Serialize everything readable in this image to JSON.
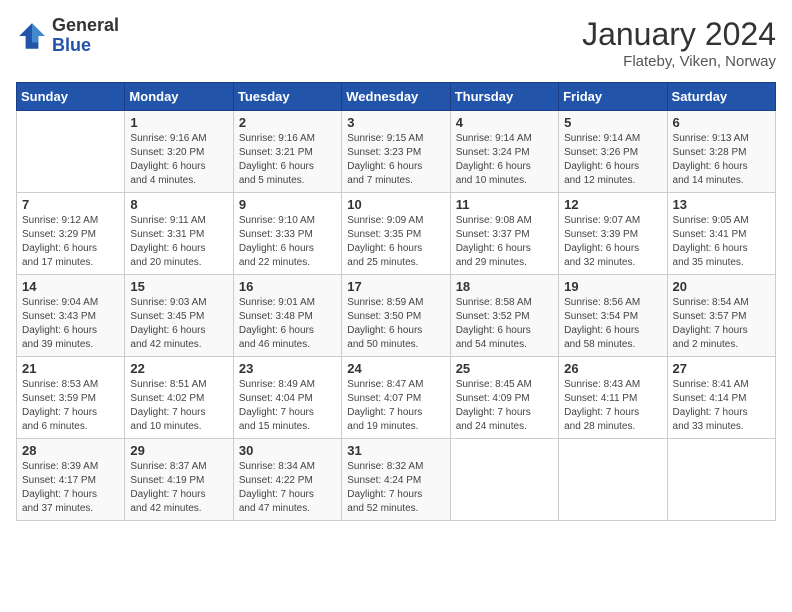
{
  "logo": {
    "general": "General",
    "blue": "Blue"
  },
  "title": "January 2024",
  "location": "Flateby, Viken, Norway",
  "days_of_week": [
    "Sunday",
    "Monday",
    "Tuesday",
    "Wednesday",
    "Thursday",
    "Friday",
    "Saturday"
  ],
  "weeks": [
    [
      {
        "day": "",
        "detail": ""
      },
      {
        "day": "1",
        "detail": "Sunrise: 9:16 AM\nSunset: 3:20 PM\nDaylight: 6 hours\nand 4 minutes."
      },
      {
        "day": "2",
        "detail": "Sunrise: 9:16 AM\nSunset: 3:21 PM\nDaylight: 6 hours\nand 5 minutes."
      },
      {
        "day": "3",
        "detail": "Sunrise: 9:15 AM\nSunset: 3:23 PM\nDaylight: 6 hours\nand 7 minutes."
      },
      {
        "day": "4",
        "detail": "Sunrise: 9:14 AM\nSunset: 3:24 PM\nDaylight: 6 hours\nand 10 minutes."
      },
      {
        "day": "5",
        "detail": "Sunrise: 9:14 AM\nSunset: 3:26 PM\nDaylight: 6 hours\nand 12 minutes."
      },
      {
        "day": "6",
        "detail": "Sunrise: 9:13 AM\nSunset: 3:28 PM\nDaylight: 6 hours\nand 14 minutes."
      }
    ],
    [
      {
        "day": "7",
        "detail": "Sunrise: 9:12 AM\nSunset: 3:29 PM\nDaylight: 6 hours\nand 17 minutes."
      },
      {
        "day": "8",
        "detail": "Sunrise: 9:11 AM\nSunset: 3:31 PM\nDaylight: 6 hours\nand 20 minutes."
      },
      {
        "day": "9",
        "detail": "Sunrise: 9:10 AM\nSunset: 3:33 PM\nDaylight: 6 hours\nand 22 minutes."
      },
      {
        "day": "10",
        "detail": "Sunrise: 9:09 AM\nSunset: 3:35 PM\nDaylight: 6 hours\nand 25 minutes."
      },
      {
        "day": "11",
        "detail": "Sunrise: 9:08 AM\nSunset: 3:37 PM\nDaylight: 6 hours\nand 29 minutes."
      },
      {
        "day": "12",
        "detail": "Sunrise: 9:07 AM\nSunset: 3:39 PM\nDaylight: 6 hours\nand 32 minutes."
      },
      {
        "day": "13",
        "detail": "Sunrise: 9:05 AM\nSunset: 3:41 PM\nDaylight: 6 hours\nand 35 minutes."
      }
    ],
    [
      {
        "day": "14",
        "detail": "Sunrise: 9:04 AM\nSunset: 3:43 PM\nDaylight: 6 hours\nand 39 minutes."
      },
      {
        "day": "15",
        "detail": "Sunrise: 9:03 AM\nSunset: 3:45 PM\nDaylight: 6 hours\nand 42 minutes."
      },
      {
        "day": "16",
        "detail": "Sunrise: 9:01 AM\nSunset: 3:48 PM\nDaylight: 6 hours\nand 46 minutes."
      },
      {
        "day": "17",
        "detail": "Sunrise: 8:59 AM\nSunset: 3:50 PM\nDaylight: 6 hours\nand 50 minutes."
      },
      {
        "day": "18",
        "detail": "Sunrise: 8:58 AM\nSunset: 3:52 PM\nDaylight: 6 hours\nand 54 minutes."
      },
      {
        "day": "19",
        "detail": "Sunrise: 8:56 AM\nSunset: 3:54 PM\nDaylight: 6 hours\nand 58 minutes."
      },
      {
        "day": "20",
        "detail": "Sunrise: 8:54 AM\nSunset: 3:57 PM\nDaylight: 7 hours\nand 2 minutes."
      }
    ],
    [
      {
        "day": "21",
        "detail": "Sunrise: 8:53 AM\nSunset: 3:59 PM\nDaylight: 7 hours\nand 6 minutes."
      },
      {
        "day": "22",
        "detail": "Sunrise: 8:51 AM\nSunset: 4:02 PM\nDaylight: 7 hours\nand 10 minutes."
      },
      {
        "day": "23",
        "detail": "Sunrise: 8:49 AM\nSunset: 4:04 PM\nDaylight: 7 hours\nand 15 minutes."
      },
      {
        "day": "24",
        "detail": "Sunrise: 8:47 AM\nSunset: 4:07 PM\nDaylight: 7 hours\nand 19 minutes."
      },
      {
        "day": "25",
        "detail": "Sunrise: 8:45 AM\nSunset: 4:09 PM\nDaylight: 7 hours\nand 24 minutes."
      },
      {
        "day": "26",
        "detail": "Sunrise: 8:43 AM\nSunset: 4:11 PM\nDaylight: 7 hours\nand 28 minutes."
      },
      {
        "day": "27",
        "detail": "Sunrise: 8:41 AM\nSunset: 4:14 PM\nDaylight: 7 hours\nand 33 minutes."
      }
    ],
    [
      {
        "day": "28",
        "detail": "Sunrise: 8:39 AM\nSunset: 4:17 PM\nDaylight: 7 hours\nand 37 minutes."
      },
      {
        "day": "29",
        "detail": "Sunrise: 8:37 AM\nSunset: 4:19 PM\nDaylight: 7 hours\nand 42 minutes."
      },
      {
        "day": "30",
        "detail": "Sunrise: 8:34 AM\nSunset: 4:22 PM\nDaylight: 7 hours\nand 47 minutes."
      },
      {
        "day": "31",
        "detail": "Sunrise: 8:32 AM\nSunset: 4:24 PM\nDaylight: 7 hours\nand 52 minutes."
      },
      {
        "day": "",
        "detail": ""
      },
      {
        "day": "",
        "detail": ""
      },
      {
        "day": "",
        "detail": ""
      }
    ]
  ]
}
